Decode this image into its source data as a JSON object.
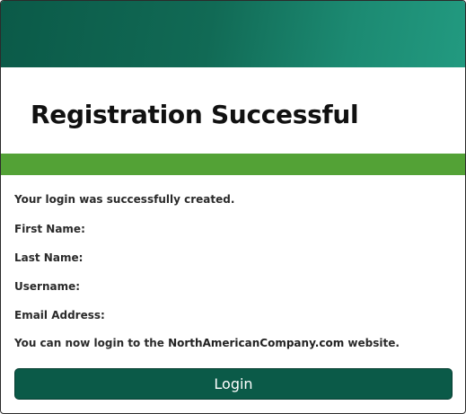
{
  "page": {
    "title": "Registration Successful"
  },
  "message": {
    "success": "Your login was successfully created.",
    "first_name_label": "First Name:",
    "last_name_label": "Last Name:",
    "username_label": "Username:",
    "email_label": "Email Address:",
    "login_prefix": "You can now login to the ",
    "site_domain": "NorthAmericanCompany.com",
    "login_suffix": " website."
  },
  "actions": {
    "login_label": "Login"
  },
  "colors": {
    "header_dark": "#0b5a48",
    "header_light": "#229a80",
    "accent_green": "#53a236",
    "button_bg": "#0b5a48"
  }
}
